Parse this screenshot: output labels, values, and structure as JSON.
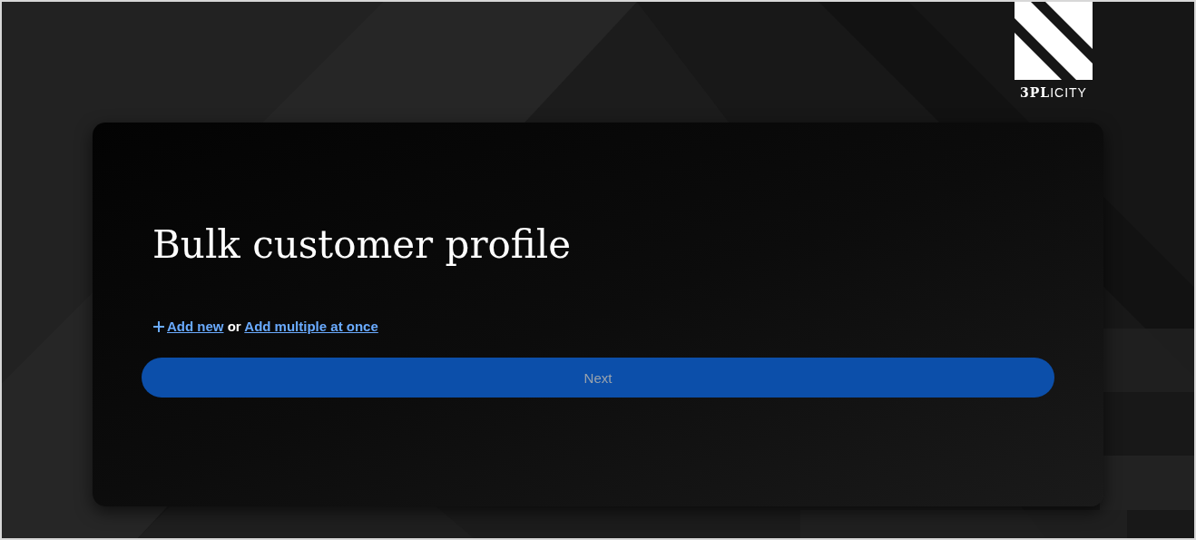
{
  "logo": {
    "text": "**3PL**ICITY"
  },
  "title": "Bulk customer profile",
  "add_options": {
    "add_new_link": "Add new",
    "separator": "or",
    "add_multiple_link": "Add multiple at once"
  },
  "next_button": {
    "label": "Next",
    "disabled": true
  }
}
